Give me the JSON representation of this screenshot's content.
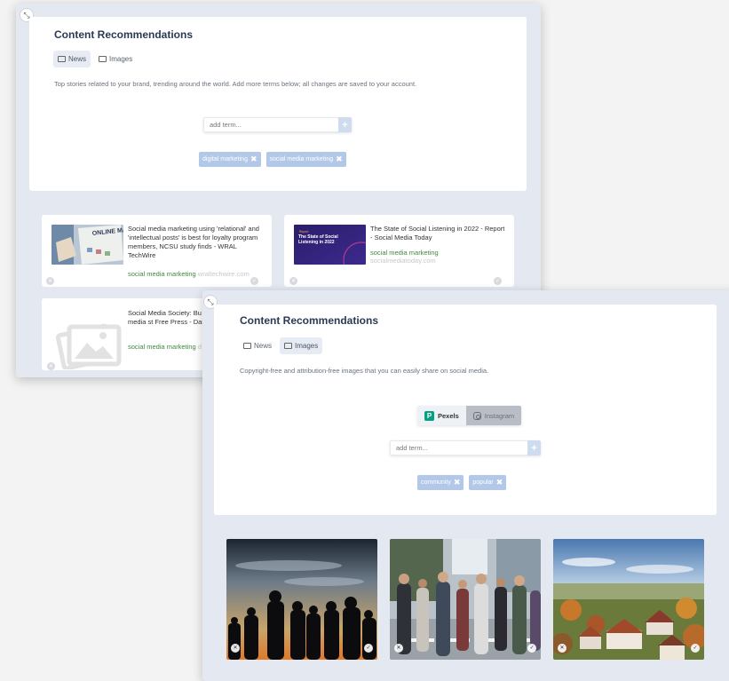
{
  "panel_news": {
    "title": "Content Recommendations",
    "tabs": [
      {
        "label": "News",
        "icon": "newspaper-icon",
        "active": true
      },
      {
        "label": "Images",
        "icon": "image-icon",
        "active": false
      }
    ],
    "description": "Top stories related to your brand, trending around the world. Add more terms below; all changes are saved to your account.",
    "add_term_placeholder": "add term...",
    "add_button": "+",
    "terms": [
      {
        "label": "digital marketing",
        "remove": "✖"
      },
      {
        "label": "social media marketing",
        "remove": "✖"
      }
    ],
    "articles": [
      {
        "headline": "Social media marketing using 'relational' and 'intellectual posts' is best for loyalty program members, NCSU study finds - WRAL TechWire",
        "topic": "social media marketing",
        "domain": "wraltechwire.com",
        "thumb_text": "ONLINE MARKETING"
      },
      {
        "headline": "The State of Social Listening in 2022 - Report - Social Media Today",
        "topic": "social media marketing",
        "domain": "socialmediatoday.com",
        "thumb_text": "The State of Social Listening in 2022",
        "thumb_kicker": "Report"
      },
      {
        "headline": "Social Media Society: Bu thanks to social media st Free Press - Daily Free P",
        "topic": "social media marketing",
        "domain": "d"
      }
    ]
  },
  "panel_images": {
    "title": "Content Recommendations",
    "tabs": [
      {
        "label": "News",
        "icon": "newspaper-icon",
        "active": false
      },
      {
        "label": "Images",
        "icon": "image-icon",
        "active": true
      }
    ],
    "description": "Copyright-free and attribution-free images that you can easily share on social media.",
    "sources": {
      "pexels": "Pexels",
      "instagram": "Instagram"
    },
    "add_term_placeholder": "add term...",
    "add_button": "+",
    "terms": [
      {
        "label": "community",
        "remove": "✖"
      },
      {
        "label": "popular",
        "remove": "✖"
      }
    ],
    "images": [
      {
        "alt": "silhouettes-at-sunset"
      },
      {
        "alt": "crowd-crossing-street"
      },
      {
        "alt": "aerial-village-autumn"
      }
    ]
  },
  "icons": {
    "expand": "⤡",
    "remove": "✕",
    "approve": "✓"
  },
  "colors": {
    "accent": "#2a3a52",
    "tag": "#b3c8e8",
    "topic_green": "#3c8a3c",
    "pexels": "#05a081"
  }
}
